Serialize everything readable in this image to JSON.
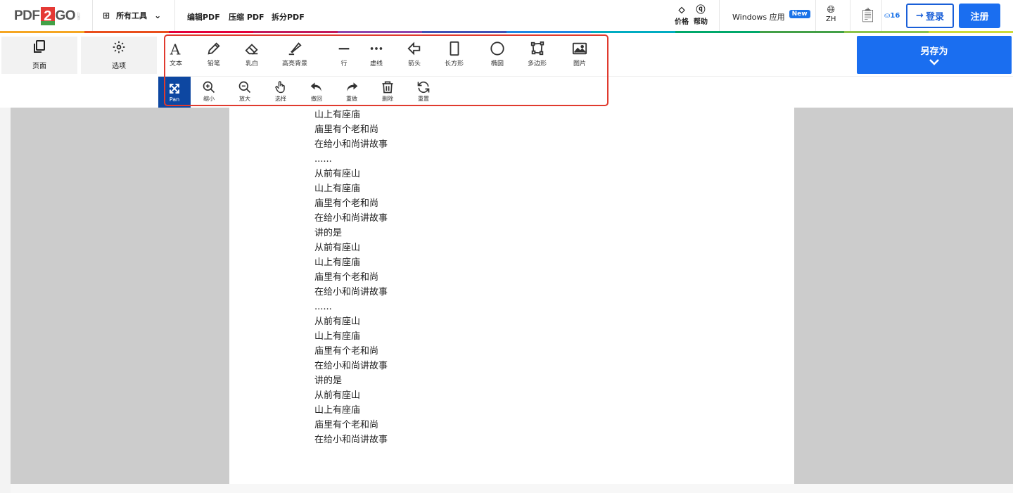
{
  "header": {
    "logo_left": "PDF",
    "logo_mid": "2",
    "logo_right": "GO",
    "logo_suffix": ".com",
    "all_tools": "所有工具",
    "nav": [
      "编辑PDF",
      "压缩 PDF",
      "拆分PDF"
    ],
    "pricing": "价格",
    "help": "帮助",
    "windows_app": "Windows 应用",
    "new_badge": "New",
    "language": "ZH",
    "credits": "16",
    "login": "登录",
    "register": "注册"
  },
  "rainbow_colors": [
    "#f5a623",
    "#e94e1b",
    "#e4003a",
    "#c2185b",
    "#8e44ad",
    "#3f51b5",
    "#1e88e5",
    "#00acc1",
    "#00a86b",
    "#43a047",
    "#8bc34a",
    "#cddc39"
  ],
  "side": {
    "pages": "页面",
    "options": "选项"
  },
  "tools_row1": [
    {
      "label": "文本",
      "icon": "text-icon"
    },
    {
      "label": "铅笔",
      "icon": "pencil-icon"
    },
    {
      "label": "乳白",
      "icon": "eraser-icon"
    },
    {
      "label": "高亮背景",
      "icon": "highlighter-icon"
    },
    {
      "label": "行",
      "icon": "line-icon"
    },
    {
      "label": "虚线",
      "icon": "dotted-line-icon"
    },
    {
      "label": "箭头",
      "icon": "arrow-icon"
    },
    {
      "label": "长方形",
      "icon": "rectangle-icon"
    },
    {
      "label": "椭圆",
      "icon": "ellipse-icon"
    },
    {
      "label": "多边形",
      "icon": "polygon-icon"
    },
    {
      "label": "图片",
      "icon": "image-icon"
    }
  ],
  "tools_row2": [
    {
      "label": "Pan",
      "icon": "pan-icon"
    },
    {
      "label": "缩小",
      "icon": "zoom-in-icon"
    },
    {
      "label": "放大",
      "icon": "zoom-out-icon"
    },
    {
      "label": "选择",
      "icon": "hand-pointer-icon"
    },
    {
      "label": "撤回",
      "icon": "undo-icon"
    },
    {
      "label": "重做",
      "icon": "redo-icon"
    },
    {
      "label": "删除",
      "icon": "trash-icon"
    },
    {
      "label": "重置",
      "icon": "reset-icon"
    }
  ],
  "save_as": "另存为",
  "document_lines": [
    "山上有座庙",
    "庙里有个老和尚",
    "在给小和尚讲故事",
    "......",
    "从前有座山",
    "山上有座庙",
    "庙里有个老和尚",
    "在给小和尚讲故事",
    "讲的是",
    "从前有座山",
    "山上有座庙",
    "庙里有个老和尚",
    "在给小和尚讲故事",
    "......",
    "从前有座山",
    "山上有座庙",
    "庙里有个老和尚",
    "在给小和尚讲故事",
    "讲的是",
    "从前有座山",
    "山上有座庙",
    "庙里有个老和尚",
    "在给小和尚讲故事"
  ]
}
